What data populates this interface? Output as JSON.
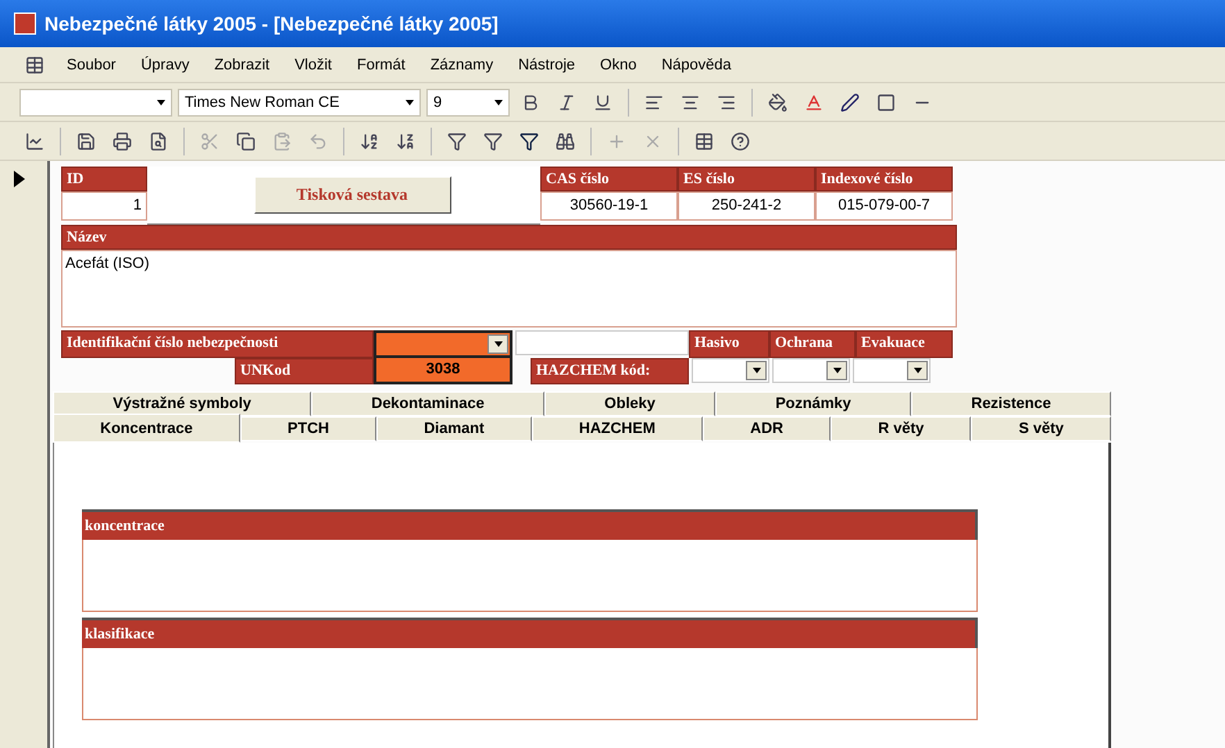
{
  "window": {
    "title": "Nebezpečné látky 2005 - [Nebezpečné látky 2005]"
  },
  "menu": [
    {
      "label": "Soubor"
    },
    {
      "label": "Úpravy"
    },
    {
      "label": "Zobrazit"
    },
    {
      "label": "Vložit"
    },
    {
      "label": "Formát"
    },
    {
      "label": "Záznamy"
    },
    {
      "label": "Nástroje"
    },
    {
      "label": "Okno"
    },
    {
      "label": "Nápověda"
    }
  ],
  "format_toolbar": {
    "font": "Times New Roman CE",
    "size": "9"
  },
  "record": {
    "id": {
      "label": "ID",
      "value": "1"
    },
    "print_button": "Tisková sestava",
    "codes": [
      {
        "label": "CAS číslo",
        "value": "30560-19-1"
      },
      {
        "label": "ES číslo",
        "value": "250-241-2"
      },
      {
        "label": "Indexové číslo",
        "value": "015-079-00-7"
      }
    ],
    "name": {
      "label": "Název",
      "value": "Acefát (ISO)"
    },
    "hazard_id": {
      "label": "Identifikační číslo nebezpečnosti"
    },
    "hazchem_columns": [
      "Hasivo",
      "Ochrana",
      "Evakuace"
    ],
    "unkod": {
      "label": "UNKod",
      "value": "3038"
    },
    "hazchem": {
      "label": "HAZCHEM kód:"
    }
  },
  "tabs": [
    [
      {
        "label": "Výstražné symboly",
        "selected": false
      },
      {
        "label": "Dekontaminace",
        "selected": false
      },
      {
        "label": "Obleky",
        "selected": false
      },
      {
        "label": "Poznámky",
        "selected": false
      },
      {
        "label": "Rezistence",
        "selected": false
      }
    ],
    [
      {
        "label": "Koncentrace",
        "selected": true
      },
      {
        "label": "PTCH",
        "selected": false
      },
      {
        "label": "Diamant",
        "selected": false
      },
      {
        "label": "HAZCHEM",
        "selected": false
      },
      {
        "label": "ADR",
        "selected": false
      },
      {
        "label": "R věty",
        "selected": false
      },
      {
        "label": "S věty",
        "selected": false
      }
    ]
  ],
  "sections": [
    {
      "label": "koncentrace"
    },
    {
      "label": "klasifikace"
    }
  ]
}
